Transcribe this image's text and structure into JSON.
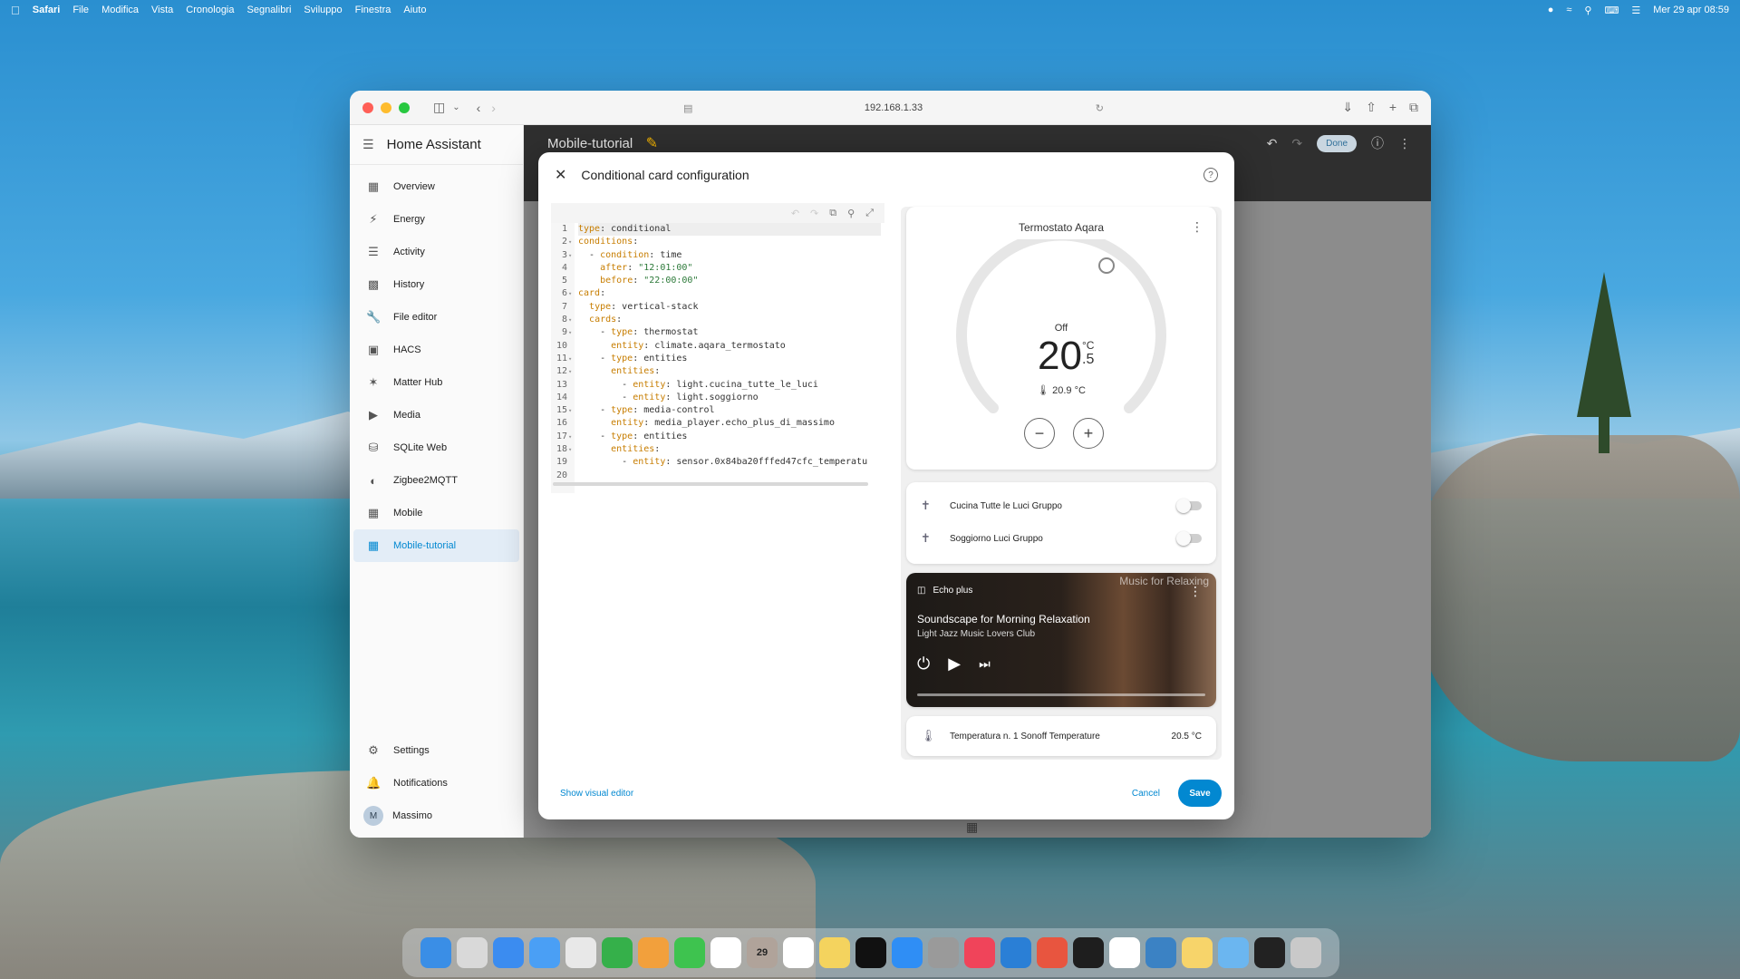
{
  "menubar": {
    "app": "Safari",
    "items": [
      "File",
      "Modifica",
      "Vista",
      "Cronologia",
      "Segnalibri",
      "Sviluppo",
      "Finestra",
      "Aiuto"
    ],
    "datetime": "Mer 29 apr 08:59"
  },
  "browser": {
    "url": "192.168.1.33"
  },
  "sidebar": {
    "title": "Home Assistant",
    "items": [
      {
        "label": "Overview",
        "icon": "grid-icon"
      },
      {
        "label": "Energy",
        "icon": "bolt-icon"
      },
      {
        "label": "Activity",
        "icon": "list-icon"
      },
      {
        "label": "History",
        "icon": "chart-icon"
      },
      {
        "label": "File editor",
        "icon": "wrench-icon"
      },
      {
        "label": "HACS",
        "icon": "store-icon"
      },
      {
        "label": "Matter Hub",
        "icon": "hub-icon"
      },
      {
        "label": "Media",
        "icon": "media-icon"
      },
      {
        "label": "SQLite Web",
        "icon": "database-icon"
      },
      {
        "label": "Zigbee2MQTT",
        "icon": "zigbee-icon"
      },
      {
        "label": "Mobile",
        "icon": "grid-icon"
      },
      {
        "label": "Mobile-tutorial",
        "icon": "grid-icon"
      }
    ],
    "bottom": {
      "settings": "Settings",
      "notifications": "Notifications",
      "user": "Massimo",
      "user_initial": "M"
    }
  },
  "topbar": {
    "title": "Mobile-tutorial",
    "done_label": "Done"
  },
  "dialog": {
    "title": "Conditional card configuration",
    "visual_editor_link": "Show visual editor",
    "cancel_label": "Cancel",
    "save_label": "Save"
  },
  "code_lines": [
    [
      [
        "k",
        "type"
      ],
      [
        "v",
        ": conditional"
      ]
    ],
    [
      [
        "k",
        "conditions"
      ],
      [
        "v",
        ":"
      ]
    ],
    [
      [
        "v",
        "  - "
      ],
      [
        "k",
        "condition"
      ],
      [
        "v",
        ": time"
      ]
    ],
    [
      [
        "v",
        "    "
      ],
      [
        "k",
        "after"
      ],
      [
        "v",
        ": "
      ],
      [
        "s",
        "\"12:01:00\""
      ]
    ],
    [
      [
        "v",
        "    "
      ],
      [
        "k",
        "before"
      ],
      [
        "v",
        ": "
      ],
      [
        "s",
        "\"22:00:00\""
      ]
    ],
    [
      [
        "k",
        "card"
      ],
      [
        "v",
        ":"
      ]
    ],
    [
      [
        "v",
        "  "
      ],
      [
        "k",
        "type"
      ],
      [
        "v",
        ": vertical-stack"
      ]
    ],
    [
      [
        "v",
        "  "
      ],
      [
        "k",
        "cards"
      ],
      [
        "v",
        ":"
      ]
    ],
    [
      [
        "v",
        "    - "
      ],
      [
        "k",
        "type"
      ],
      [
        "v",
        ": thermostat"
      ]
    ],
    [
      [
        "v",
        "      "
      ],
      [
        "k",
        "entity"
      ],
      [
        "v",
        ": climate.aqara_termostato"
      ]
    ],
    [
      [
        "v",
        "    - "
      ],
      [
        "k",
        "type"
      ],
      [
        "v",
        ": entities"
      ]
    ],
    [
      [
        "v",
        "      "
      ],
      [
        "k",
        "entities"
      ],
      [
        "v",
        ":"
      ]
    ],
    [
      [
        "v",
        "        - "
      ],
      [
        "k",
        "entity"
      ],
      [
        "v",
        ": light.cucina_tutte_le_luci"
      ]
    ],
    [
      [
        "v",
        "        - "
      ],
      [
        "k",
        "entity"
      ],
      [
        "v",
        ": light.soggiorno"
      ]
    ],
    [
      [
        "v",
        "    - "
      ],
      [
        "k",
        "type"
      ],
      [
        "v",
        ": media-control"
      ]
    ],
    [
      [
        "v",
        "      "
      ],
      [
        "k",
        "entity"
      ],
      [
        "v",
        ": media_player.echo_plus_di_massimo"
      ]
    ],
    [
      [
        "v",
        "    - "
      ],
      [
        "k",
        "type"
      ],
      [
        "v",
        ": entities"
      ]
    ],
    [
      [
        "v",
        "      "
      ],
      [
        "k",
        "entities"
      ],
      [
        "v",
        ":"
      ]
    ],
    [
      [
        "v",
        "        - "
      ],
      [
        "k",
        "entity"
      ],
      [
        "v",
        ": sensor.0x84ba20fffed47cfc_temperatu"
      ]
    ],
    []
  ],
  "thermostat": {
    "name": "Termostato Aqara",
    "mode": "Off",
    "target_int": "20",
    "target_dec": ".5",
    "unit": "°C",
    "current": "20.9 °C",
    "minus": "−",
    "plus": "+"
  },
  "entities": [
    {
      "label": "Cucina Tutte le Luci Gruppo",
      "icon": "lamp-icon",
      "on": false
    },
    {
      "label": "Soggiorno Luci Gruppo",
      "icon": "lamp-off-icon",
      "on": false
    }
  ],
  "media": {
    "source": "Echo plus",
    "art_text": "Music for Relaxing",
    "title": "Soundscape for Morning Relaxation",
    "artist": "Light Jazz Music Lovers Club"
  },
  "sensor": {
    "label": "Temperatura n. 1 Sonoff Temperature",
    "value": "20.5 °C"
  },
  "dock": {
    "date_label": "29",
    "colors": [
      "#3a8ee6",
      "#d9d9d9",
      "#3b8cf0",
      "#4a9ff5",
      "#e8e8e8",
      "#35b04a",
      "#f2a03c",
      "#3ec34f",
      "#ffffff",
      "#b0a39a",
      "#ffffff",
      "#f4d35e",
      "#111111",
      "#2f8ef5",
      "#9a9a9a",
      "#f0445a",
      "#2a7fd6",
      "#e8553f",
      "#1e1e1e",
      "#ffffff",
      "#3b82c4",
      "#f7d46a",
      "#6bb6f0",
      "#222222",
      "#c9c9c9"
    ]
  }
}
